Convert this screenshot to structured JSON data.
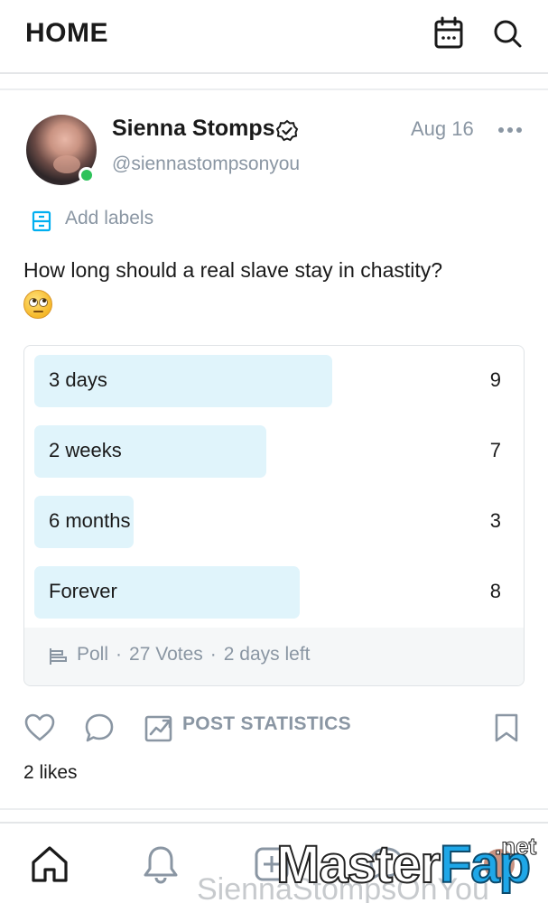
{
  "header": {
    "title": "HOME",
    "icons": [
      "calendar-icon",
      "search-icon"
    ]
  },
  "post": {
    "author_name": "Sienna Stomps",
    "author_handle": "@siennastompsonyou",
    "date": "Aug 16",
    "online": true,
    "labels_text": "Add labels",
    "text": "How long should a real slave stay in chastity?",
    "emoji": "face-with-rolling-eyes"
  },
  "poll": {
    "options": [
      {
        "label": "3 days",
        "count": "9",
        "votes": 9
      },
      {
        "label": "2 weeks",
        "count": "7",
        "votes": 7
      },
      {
        "label": "6 months",
        "count": "3",
        "votes": 3
      },
      {
        "label": "Forever",
        "count": "8",
        "votes": 8
      }
    ],
    "footer": {
      "type": "Poll",
      "votes": "27 Votes",
      "time_left": "2 days left",
      "separator": "·"
    }
  },
  "actions": {
    "stats_label": "POST STATISTICS",
    "likes": "2 likes"
  },
  "tabbar": {
    "items": [
      "home-icon",
      "bell-icon",
      "add-post-icon",
      "chat-icon",
      "profile-icon"
    ]
  },
  "watermark": {
    "text": "SiennaStompsOnYou",
    "logo_master": "Master",
    "logo_fap": "Fap",
    "logo_net": ".net"
  },
  "colors": {
    "accent": "#00aff0",
    "muted": "#8a96a3",
    "poll_fill": "#e0f4fb",
    "online": "#2ec25a"
  }
}
